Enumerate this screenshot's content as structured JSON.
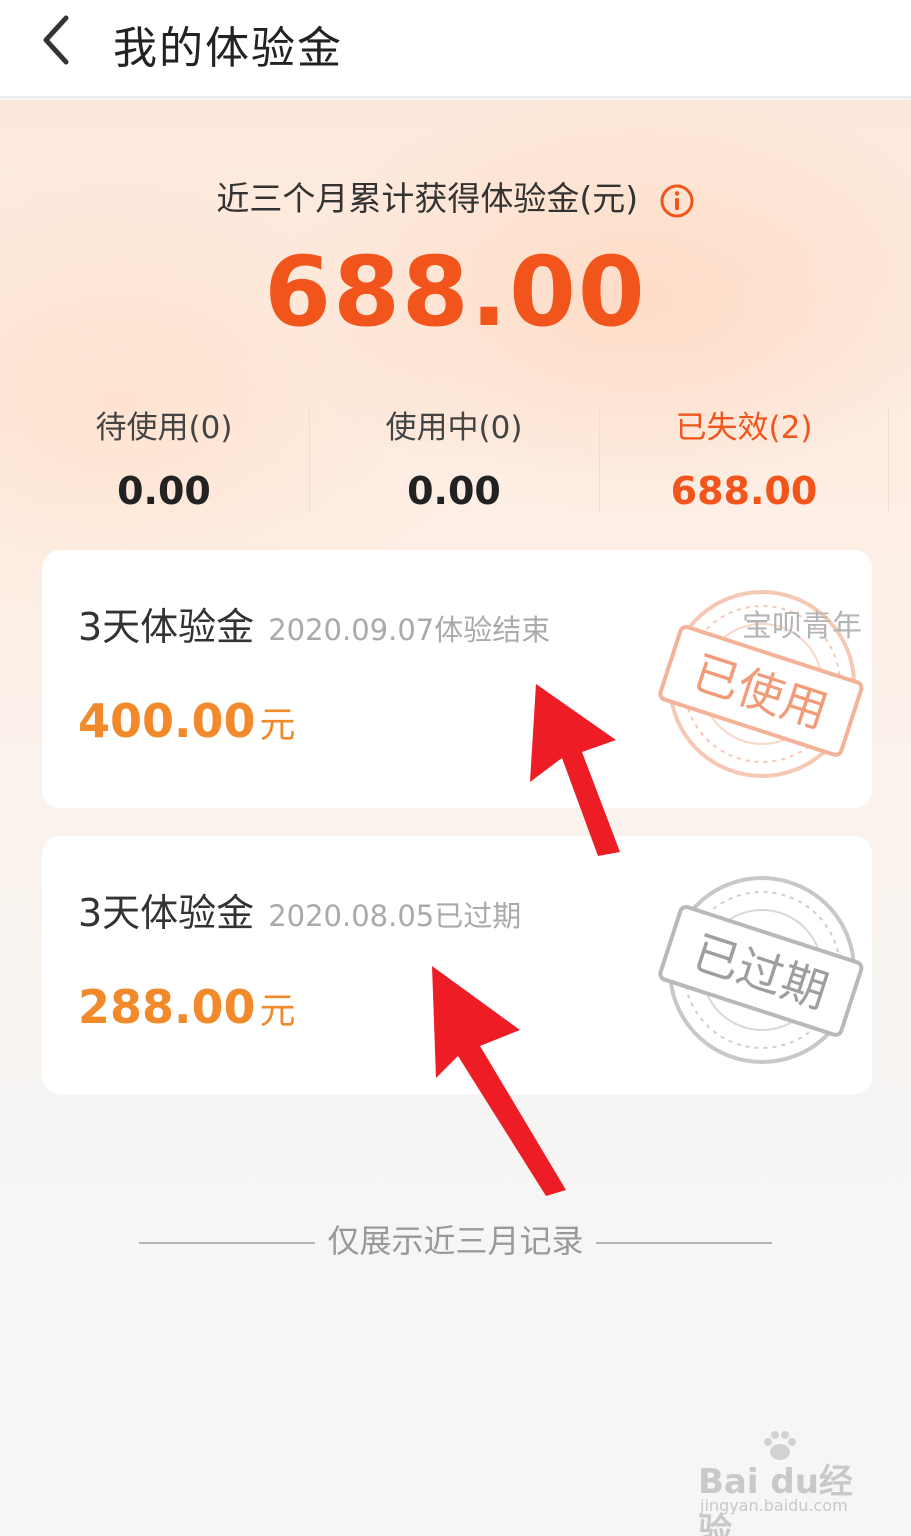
{
  "header": {
    "title": "我的体验金"
  },
  "summary": {
    "label": "近三个月累计获得体验金(元)",
    "amount": "688.00"
  },
  "stats": [
    {
      "label": "待使用(0)",
      "value": "0.00"
    },
    {
      "label": "使用中(0)",
      "value": "0.00"
    },
    {
      "label": "已失效(2)",
      "value": "688.00"
    }
  ],
  "cards": [
    {
      "title": "3天体验金",
      "date": "2020.09.07体验结束",
      "amount": "400.00",
      "unit": "元",
      "stamp_brand": "宝呗青年",
      "stamp_status": "已使用"
    },
    {
      "title": "3天体验金",
      "date": "2020.08.05已过期",
      "amount": "288.00",
      "unit": "元",
      "stamp_status": "已过期"
    }
  ],
  "footer": {
    "note": "仅展示近三月记录"
  },
  "watermark": {
    "text": "Bai du经验",
    "url": "jingyan.baidu.com"
  },
  "colors": {
    "accent": "#f2551c",
    "amount": "#f08a2a",
    "annotation_arrow": "#ee1c25"
  },
  "icons": [
    "chevron-left-icon",
    "info-icon",
    "used-stamp-icon",
    "expired-stamp-icon",
    "red-arrow-icon"
  ]
}
